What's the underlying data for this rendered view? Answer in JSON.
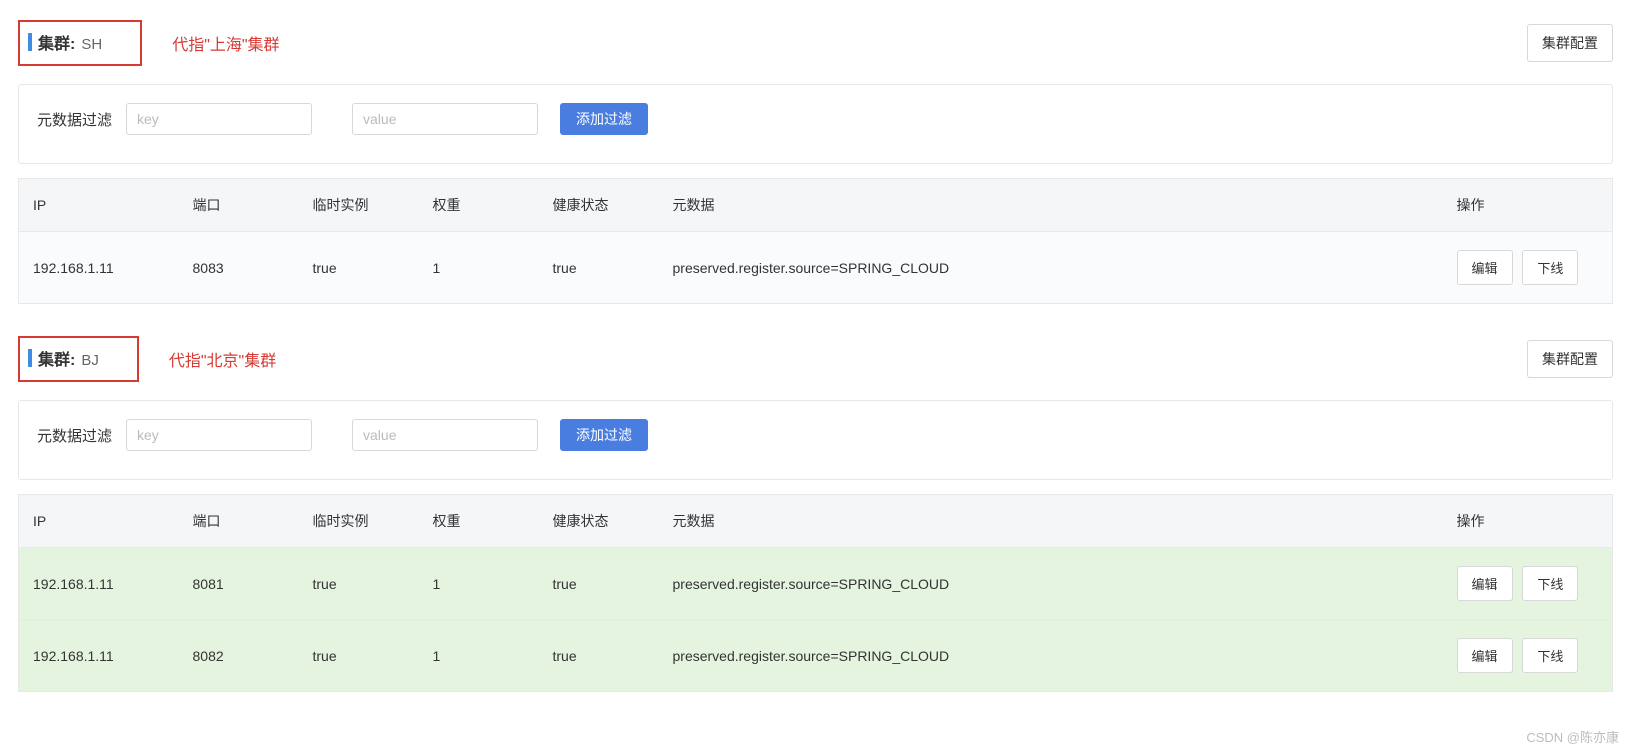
{
  "common": {
    "cluster_label": "集群:",
    "config_btn": "集群配置",
    "filter_label": "元数据过滤",
    "key_placeholder": "key",
    "value_placeholder": "value",
    "add_filter_btn": "添加过滤",
    "edit_btn": "编辑",
    "offline_btn": "下线",
    "columns": {
      "ip": "IP",
      "port": "端口",
      "temp": "临时实例",
      "weight": "权重",
      "health": "健康状态",
      "meta": "元数据",
      "ops": "操作"
    }
  },
  "watermark": "CSDN @陈亦康",
  "clusters": [
    {
      "code": "SH",
      "annotation": "代指\"上海\"集群",
      "row_style": "normal",
      "rows": [
        {
          "ip": "192.168.1.11",
          "port": "8083",
          "temp": "true",
          "weight": "1",
          "health": "true",
          "meta": "preserved.register.source=SPRING_CLOUD"
        }
      ]
    },
    {
      "code": "BJ",
      "annotation": "代指\"北京\"集群",
      "row_style": "green",
      "rows": [
        {
          "ip": "192.168.1.11",
          "port": "8081",
          "temp": "true",
          "weight": "1",
          "health": "true",
          "meta": "preserved.register.source=SPRING_CLOUD"
        },
        {
          "ip": "192.168.1.11",
          "port": "8082",
          "temp": "true",
          "weight": "1",
          "health": "true",
          "meta": "preserved.register.source=SPRING_CLOUD"
        }
      ]
    }
  ]
}
